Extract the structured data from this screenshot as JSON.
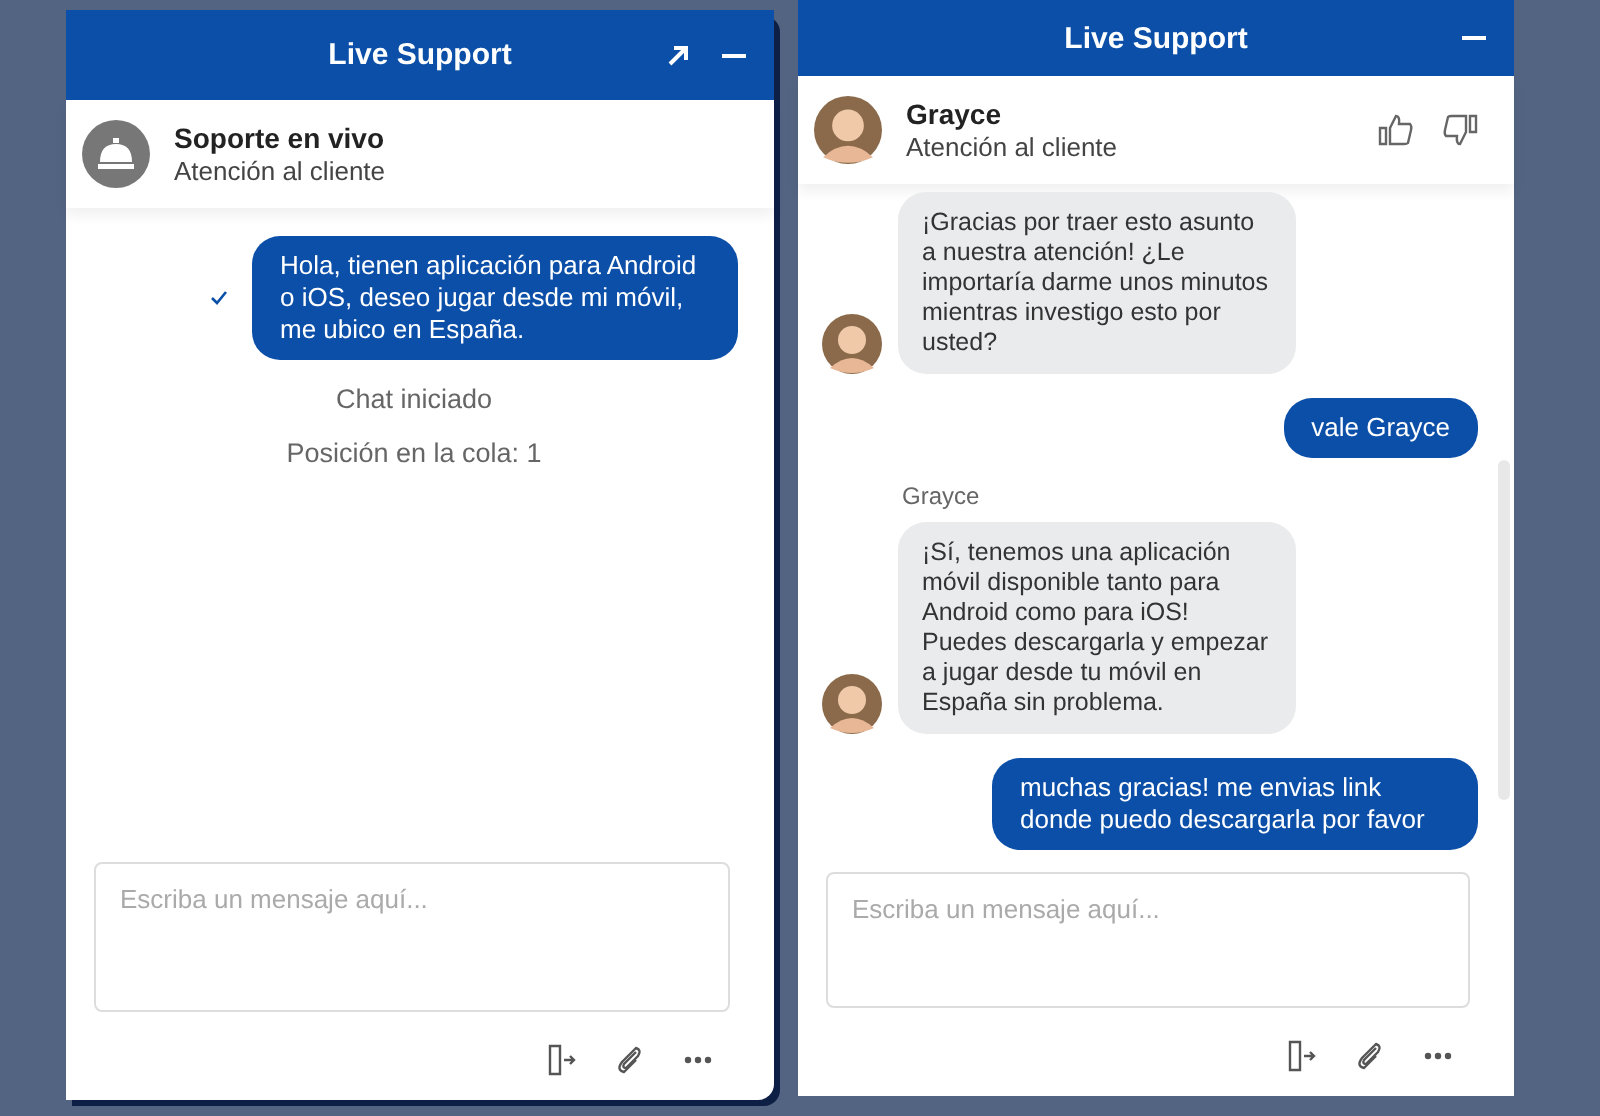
{
  "panels": [
    {
      "title": "Live Support",
      "popout": true,
      "agent": {
        "name": "Soporte en vivo",
        "subtitle": "Atención al cliente",
        "kind": "bell"
      },
      "rating": false,
      "scrollbar": false,
      "messages": [
        {
          "kind": "outgoing",
          "text": "Hola, tienen aplicación para Android o iOS, deseo jugar desde mi móvil, me ubico en España.",
          "delivered": true
        },
        {
          "kind": "system",
          "text": "Chat iniciado"
        },
        {
          "kind": "system",
          "text": "Posición en la cola: 1"
        }
      ],
      "input": {
        "placeholder": "Escriba un mensaje aquí..."
      }
    },
    {
      "title": "Live Support",
      "popout": false,
      "agent": {
        "name": "Grayce",
        "subtitle": "Atención al cliente",
        "kind": "person"
      },
      "rating": true,
      "scrollbar": true,
      "messages": [
        {
          "kind": "incoming",
          "text": "¡Gracias por traer esto asunto a nuestra atención! ¿Le importaría darme unos minutos mientras investigo esto por usted?"
        },
        {
          "kind": "outgoing",
          "text": "vale Grayce",
          "delivered": false
        },
        {
          "kind": "sender",
          "text": "Grayce"
        },
        {
          "kind": "incoming",
          "text": "¡Sí, tenemos una aplicación móvil disponible tanto para Android como para iOS! Puedes descargarla y empezar a jugar desde tu móvil en España sin problema."
        },
        {
          "kind": "outgoing",
          "text": "muchas gracias! me envias link donde puedo descargarla por favor",
          "delivered": false
        }
      ],
      "input": {
        "placeholder": "Escriba un mensaje aquí..."
      }
    }
  ]
}
